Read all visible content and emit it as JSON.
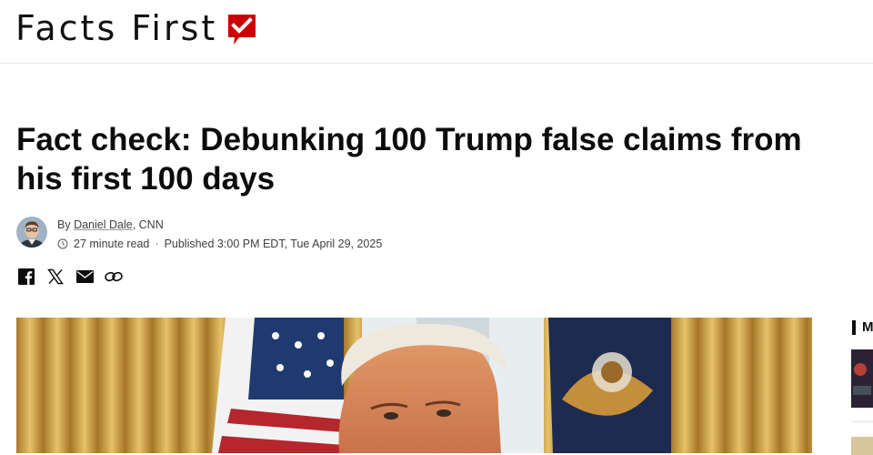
{
  "header": {
    "logo_text": "Facts First",
    "logo_badge_icon": "checkmark-speech-bubble-icon",
    "brand_color": "#cc0000"
  },
  "article": {
    "headline": "Fact check: Debunking 100 Trump false claims from his first 100 days",
    "byline_prefix": "By ",
    "author": "Daniel Dale",
    "outlet": ", CNN",
    "read_time": "27 minute read",
    "separator": "·",
    "published": "Published 3:00 PM EDT, Tue April 29, 2025"
  },
  "share": {
    "icons": [
      "facebook-icon",
      "x-icon",
      "email-icon",
      "link-icon"
    ]
  },
  "right_rail": {
    "heading_letter": "M"
  }
}
